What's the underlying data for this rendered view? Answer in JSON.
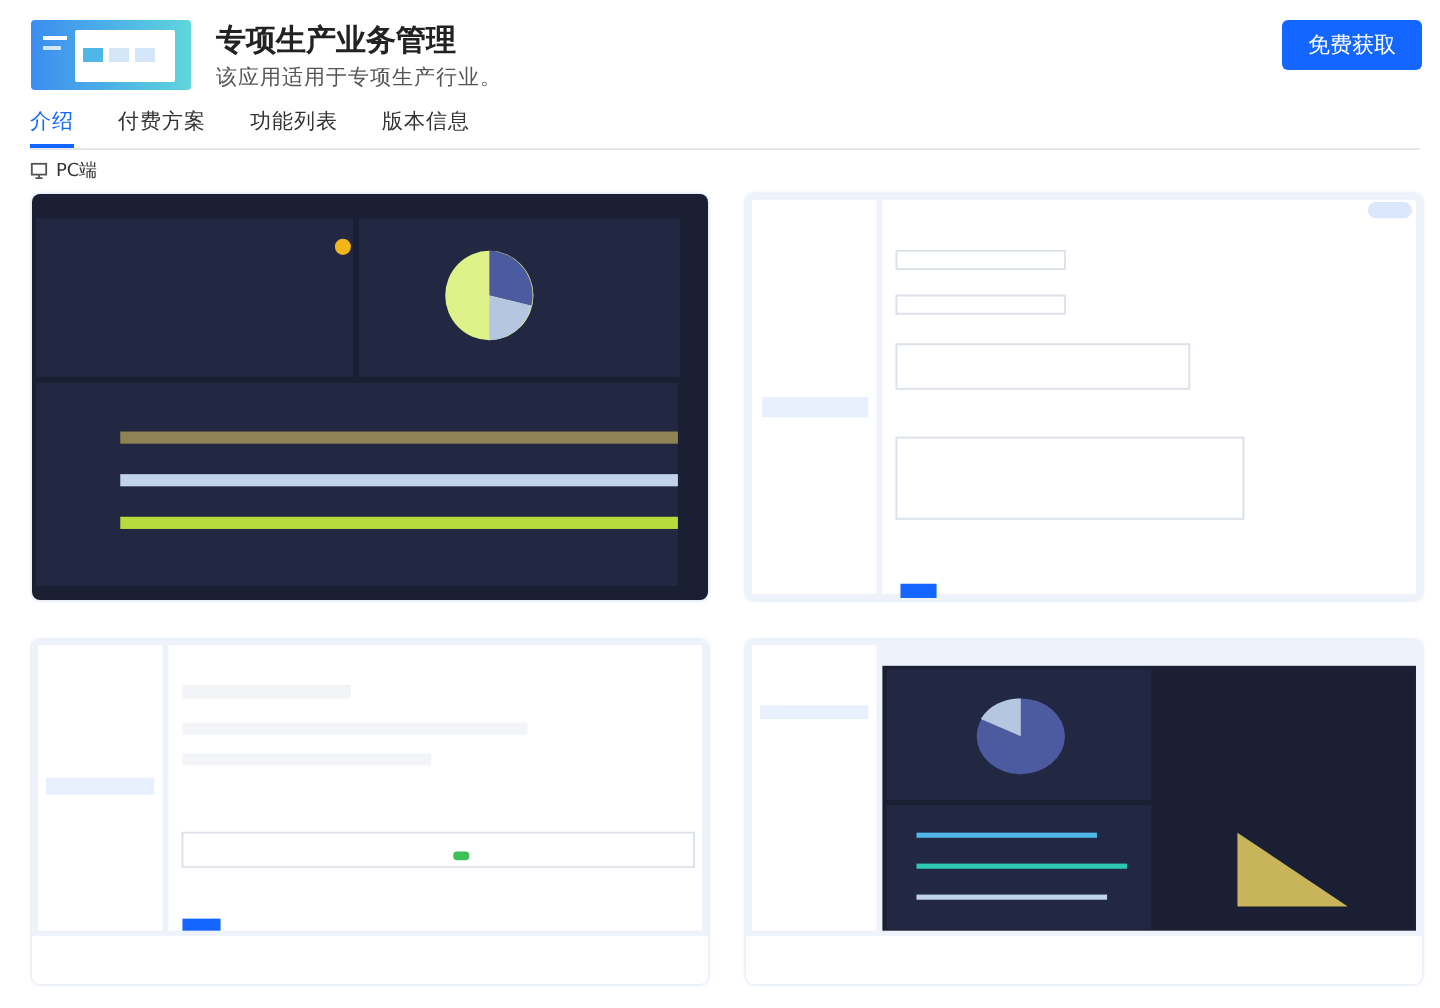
{
  "app": {
    "title": "专项生产业务管理",
    "description": "该应用适用于专项生产行业。",
    "action": "免费获取"
  },
  "tabs": [
    {
      "label": "介绍",
      "selected": true
    },
    {
      "label": "付费方案",
      "selected": false
    },
    {
      "label": "功能列表",
      "selected": false
    },
    {
      "label": "版本信息",
      "selected": false
    }
  ],
  "platform": "PC端"
}
